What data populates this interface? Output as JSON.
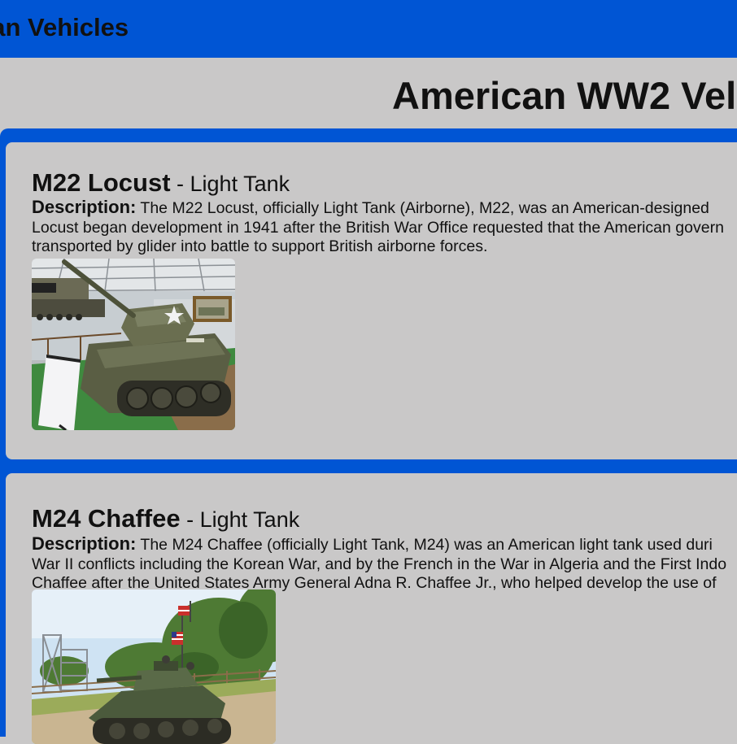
{
  "header": {
    "site_title": "can Vehicles"
  },
  "page": {
    "heading": "American WW2 Vel"
  },
  "vehicles": [
    {
      "name": "M22 Locust",
      "separator": " - ",
      "type": "Light Tank",
      "description_label": "Description:",
      "description_lines": [
        " The M22 Locust, officially Light Tank (Airborne), M22, was an American-designed",
        "Locust began development in 1941 after the British War Office requested that the American govern",
        "transported by glider into battle to support British airborne forces."
      ]
    },
    {
      "name": "M24 Chaffee",
      "separator": " - ",
      "type": "Light Tank",
      "description_label": "Description:",
      "description_lines": [
        " The M24 Chaffee (officially Light Tank, M24) was an American light tank used duri",
        "War II conflicts including the Korean War, and by the French in the War in Algeria and the First Indo",
        "Chaffee after the United States Army General Adna R. Chaffee Jr., who helped develop the use of"
      ]
    }
  ],
  "colors": {
    "accent_blue": "#0055d4",
    "panel_gray": "#c9c8c8",
    "text": "#111111"
  }
}
